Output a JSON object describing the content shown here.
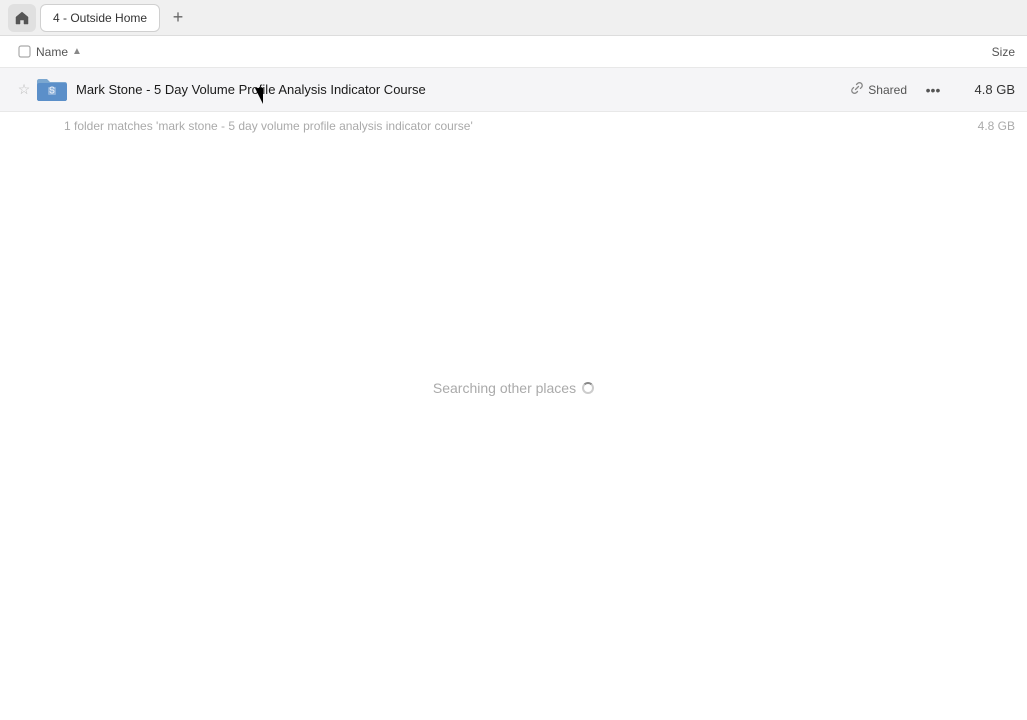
{
  "tab_bar": {
    "home_icon": "🏠",
    "tab_label": "4 - Outside Home",
    "add_icon": "+"
  },
  "column_headers": {
    "name_label": "Name",
    "sort_arrow": "▲",
    "size_label": "Size"
  },
  "file_row": {
    "star_icon": "☆",
    "folder_color_top": "#6a9fd8",
    "folder_color_bottom": "#5b8fc9",
    "file_name": "Mark Stone - 5 Day Volume Profile Analysis Indicator Course",
    "shared_label": "Shared",
    "link_icon": "🔗",
    "more_icon": "···",
    "file_size": "4.8 GB"
  },
  "summary": {
    "text": "1 folder matches 'mark stone - 5 day volume profile analysis indicator course'",
    "size": "4.8 GB"
  },
  "searching": {
    "text": "Searching other places"
  }
}
